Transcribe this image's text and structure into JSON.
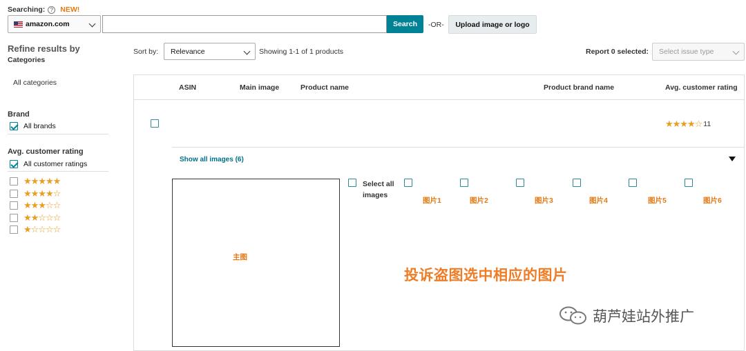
{
  "search": {
    "searching_label": "Searching:",
    "help": "?",
    "new_badge": "NEW!",
    "marketplace": "amazon.com",
    "input_value": "",
    "search_button": "Search",
    "or_text": "-OR-",
    "upload_button": "Upload image or logo"
  },
  "sidebar": {
    "title": "Refine results by",
    "subtitle": "Categories",
    "all_categories": "All categories",
    "brand_heading": "Brand",
    "all_brands": "All brands",
    "rating_heading": "Avg. customer rating",
    "all_ratings": "All customer ratings",
    "star_filters": [
      5,
      4,
      3,
      2,
      1
    ]
  },
  "toolbar": {
    "sort_label": "Sort by:",
    "sort_value": "Relevance",
    "showing": "Showing 1-1 of 1 products",
    "report": "Report 0 selected:",
    "issue_placeholder": "Select issue type"
  },
  "table": {
    "columns": [
      "ASIN",
      "Main image",
      "Product name",
      "Product brand name",
      "Avg. customer rating"
    ],
    "row": {
      "rating_stars": 4.5,
      "rating_count": "11"
    },
    "show_all_images": "Show all images (6)",
    "main_image_label": "主图",
    "select_all": "Select all",
    "select_all_2": "images",
    "image_labels": [
      "图片1",
      "图片2",
      "图片3",
      "图片4",
      "图片5",
      "图片6"
    ]
  },
  "annotation": "投诉盗图选中相应的图片",
  "watermark": "葫芦娃站外推广",
  "colors": {
    "accent": "#008296",
    "star": "#e99d21",
    "annotation": "#ef7c26"
  }
}
